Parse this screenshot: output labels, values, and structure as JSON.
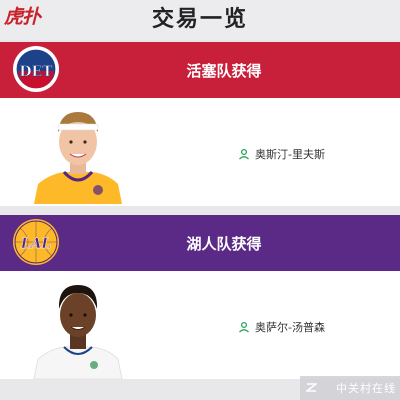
{
  "header": {
    "logo_text": "虎扑",
    "title": "交易一览"
  },
  "trades": [
    {
      "team_header": "活塞队获得",
      "team_logo_text": "DET",
      "team_color": "#c8102e",
      "player": {
        "name": "奥斯汀-里夫斯",
        "jersey_color": "#fdb927"
      }
    },
    {
      "team_header": "湖人队获得",
      "team_logo_text": "LAL",
      "team_color": "#552583",
      "player": {
        "name": "奥萨尔-汤普森",
        "jersey_color": "#ffffff"
      }
    }
  ],
  "watermark": {
    "text": "中关村在线"
  }
}
